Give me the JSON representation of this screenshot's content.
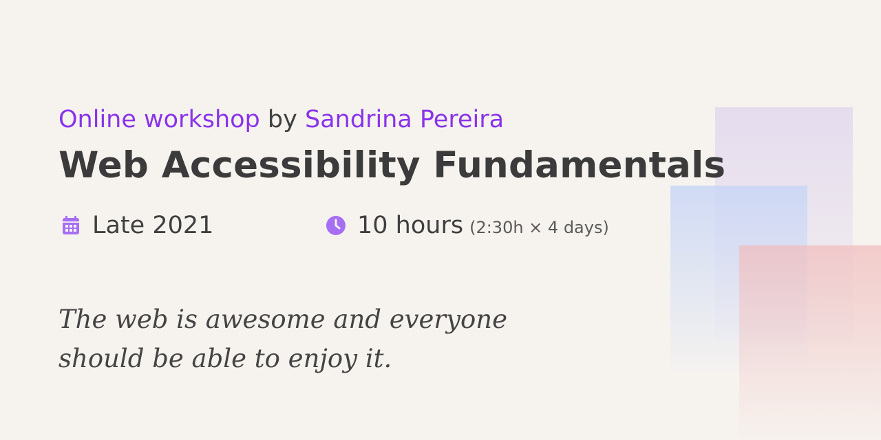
{
  "byline": {
    "event_type": "Online workshop",
    "connector": "by",
    "author": "Sandrina Pereira"
  },
  "title": "Web Accessibility Fundamentals",
  "meta": {
    "date": {
      "icon": "calendar-icon",
      "text": "Late 2021"
    },
    "duration": {
      "icon": "clock-icon",
      "text": "10 hours",
      "detail": "(2:30h × 4 days)"
    }
  },
  "tagline": {
    "line1": "The web is awesome and everyone",
    "line2": "should be able to enjoy it."
  },
  "colors": {
    "accent": "#8a33ea",
    "icon": "#a66ef3",
    "text": "#3f3f3f",
    "background": "#f6f3ef"
  }
}
